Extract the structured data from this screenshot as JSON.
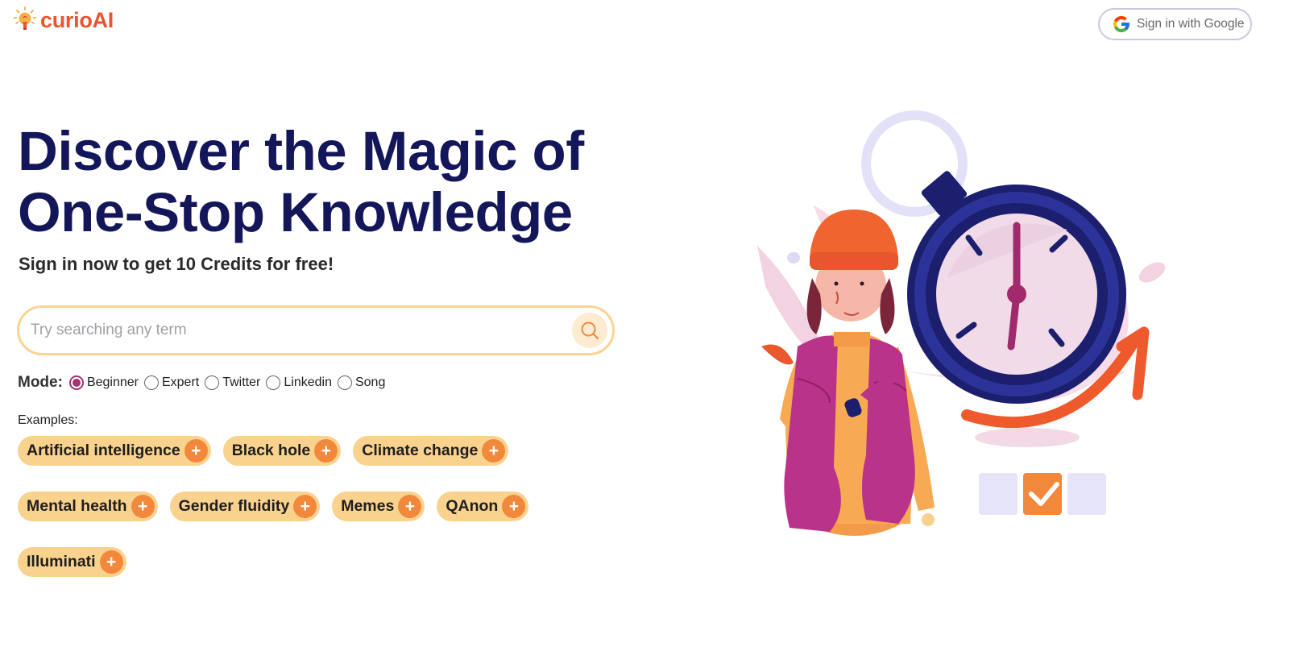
{
  "brand": {
    "name": "curioAI",
    "color": "#e8552f"
  },
  "header": {
    "sign_in_label": "Sign in with Google"
  },
  "hero": {
    "title_line1": "Discover the Magic of",
    "title_line2": "One-Stop Knowledge",
    "subtitle": "Sign in now to get 10 Credits for free!"
  },
  "search": {
    "placeholder": "Try searching any term",
    "value": ""
  },
  "mode": {
    "label": "Mode:",
    "selected": "Beginner",
    "options": [
      "Beginner",
      "Expert",
      "Twitter",
      "Linkedin",
      "Song"
    ]
  },
  "examples": {
    "label": "Examples:",
    "items": [
      "Artificial intelligence",
      "Black hole",
      "Climate change",
      "Mental health",
      "Gender fluidity",
      "Memes",
      "QAnon",
      "Illuminati"
    ],
    "plus_symbol": "+"
  },
  "colors": {
    "title": "#14165a",
    "chip_bg": "#f9d28e",
    "chip_plus": "#f2883c",
    "search_border": "#f9d491",
    "radio_selected": "#a3326f"
  }
}
